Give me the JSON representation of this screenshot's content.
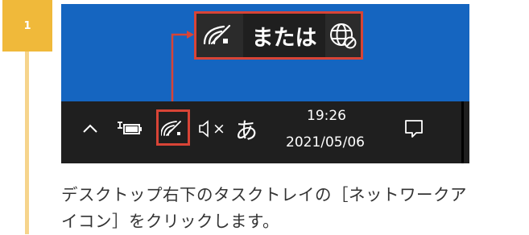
{
  "step": {
    "number": "1"
  },
  "screenshot": {
    "callout": {
      "or_text": "または"
    },
    "taskbar": {
      "chevron_glyph": "^",
      "mute_suffix": "×",
      "ime_mode": "あ",
      "clock_time": "19:26",
      "clock_date": "2021/05/06"
    }
  },
  "caption": {
    "line1": "デスクトップ右下のタスクトレイの［ネットワークア",
    "line2": "イコン］をクリックします。"
  },
  "colors": {
    "step_badge": "#f0b93a",
    "step_line": "#f6d48c",
    "desktop_blue": "#1565c0",
    "taskbar": "#1f1f1f",
    "highlight_red": "#d84436"
  },
  "icons": [
    "wifi-icon",
    "globe-no-connection-icon",
    "show-hidden-icons-chevron",
    "battery-plug-icon",
    "volume-muted-icon",
    "action-center-icon"
  ]
}
